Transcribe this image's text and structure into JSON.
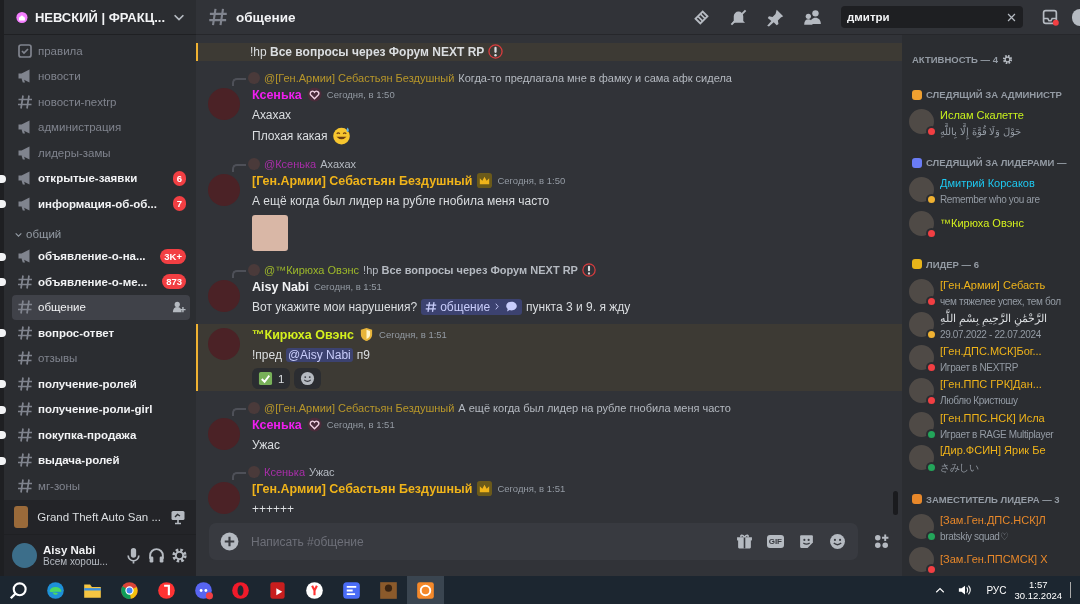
{
  "server": {
    "name": "НЕВСКИЙ | ФРАКЦ..."
  },
  "sidebar": {
    "channels": [
      {
        "name": "правила",
        "kind": "rules",
        "unread": false,
        "selected": false
      },
      {
        "name": "новости",
        "kind": "announce",
        "unread": false,
        "selected": false
      },
      {
        "name": "новости-nextrp",
        "kind": "text",
        "unread": false,
        "selected": false
      },
      {
        "name": "администрация",
        "kind": "announce",
        "unread": false,
        "selected": false
      },
      {
        "name": "лидеры-замы",
        "kind": "announce",
        "unread": false,
        "selected": false
      },
      {
        "name": "открытые-заявки",
        "kind": "announce",
        "unread": true,
        "selected": false,
        "badge": "6"
      },
      {
        "name": "информация-об-об...",
        "kind": "announce",
        "unread": true,
        "selected": false,
        "badge": "7"
      }
    ],
    "categories": [
      {
        "name": "общий",
        "expanded": true,
        "channels": [
          {
            "name": "объявление-о-на...",
            "kind": "announce",
            "unread": true,
            "selected": false,
            "badge": "3K+"
          },
          {
            "name": "объявление-о-ме...",
            "kind": "text",
            "unread": true,
            "selected": false,
            "badge": "873"
          },
          {
            "name": "общение",
            "kind": "text",
            "unread": false,
            "selected": true
          },
          {
            "name": "вопрос-ответ",
            "kind": "text",
            "unread": true,
            "selected": false
          },
          {
            "name": "отзывы",
            "kind": "text",
            "unread": false,
            "selected": false
          },
          {
            "name": "получение-ролей",
            "kind": "text",
            "unread": true,
            "selected": false
          },
          {
            "name": "получение-роли-girl",
            "kind": "text",
            "unread": true,
            "selected": false
          },
          {
            "name": "покупка-продажа",
            "kind": "text",
            "unread": true,
            "selected": false
          },
          {
            "name": "выдача-ролей",
            "kind": "text",
            "unread": true,
            "selected": false
          },
          {
            "name": "мг-зоны",
            "kind": "text",
            "unread": false,
            "selected": false
          }
        ]
      }
    ]
  },
  "activity": {
    "title": "Grand Theft Auto San ..."
  },
  "user": {
    "name": "Aisy Nabi",
    "status_text": "Всем хорош..."
  },
  "header": {
    "channel": "общение",
    "search": {
      "value": "дмитри"
    }
  },
  "messages": [
    {
      "kind": "partial",
      "mentioned": true,
      "lines": [
        [
          {
            "kind": "text",
            "text": "!hp **Все вопросы через Форум NEXT RP**"
          },
          {
            "kind": "alert"
          }
        ]
      ]
    },
    {
      "kind": "message",
      "mentioned": false,
      "reply": {
        "author": "@[Ген.Армии] Себастьян Бездушный",
        "color": "#b8972a",
        "text": "Когда-то предлагала мне в фамку и сама афк сидела"
      },
      "author": "Ксенька",
      "color": "#f01ef0",
      "badge": {
        "kind": "heart"
      },
      "time": "Сегодня, в 1:50",
      "lines": [
        [
          {
            "kind": "text",
            "text": "Ахахах"
          }
        ],
        [
          {
            "kind": "text",
            "text": "Плохая какая"
          },
          {
            "kind": "emoji"
          }
        ]
      ]
    },
    {
      "kind": "message",
      "mentioned": false,
      "reply": {
        "author": "@Ксенька",
        "color": "#a82ea8",
        "text": "Ахахах"
      },
      "author": "[Ген.Армии] Себастьян Бездушный",
      "color": "#f0b41a",
      "badge": {
        "kind": "crown"
      },
      "time": "Сегодня, в 1:50",
      "lines": [
        [
          {
            "kind": "text",
            "text": "А ещё когда был лидер на рубле гнобила меня часто"
          }
        ]
      ],
      "attachment": {
        "kind": "image"
      }
    },
    {
      "kind": "message",
      "mentioned": false,
      "reply": {
        "author": "@™Кирюха Овэнс",
        "color": "#9db82a",
        "text": "!hp **Все вопросы через Форум NEXT RP**",
        "alert": true
      },
      "author": "Aisy Nabi",
      "color": "#f2f3f5",
      "time": "Сегодня, в 1:51",
      "lines": [
        [
          {
            "kind": "text",
            "text": "Вот укажите мои нарушения?"
          },
          {
            "kind": "channel",
            "text": "общение"
          },
          {
            "kind": "text",
            "text": "пункта 3 и 9. я  жду"
          }
        ]
      ]
    },
    {
      "kind": "message",
      "mentioned": true,
      "author": "™Кирюха Овэнс",
      "color": "#d4f01e",
      "badge": {
        "kind": "shield"
      },
      "time": "Сегодня, в 1:51",
      "lines": [
        [
          {
            "kind": "text",
            "text": "!пред"
          },
          {
            "kind": "mention",
            "text": "@Aisy Nabi"
          },
          {
            "kind": "text",
            "text": "п9"
          }
        ]
      ],
      "reactions": [
        {
          "kind": "check",
          "count": "1"
        }
      ]
    },
    {
      "kind": "message",
      "mentioned": false,
      "reply": {
        "author": "@[Ген.Армии] Себастьян Бездушный",
        "color": "#b8972a",
        "text": "А ещё когда был лидер на рубле гнобила меня часто"
      },
      "author": "Ксенька",
      "color": "#f01ef0",
      "badge": {
        "kind": "heart"
      },
      "time": "Сегодня, в 1:51",
      "lines": [
        [
          {
            "kind": "text",
            "text": "Ужас"
          }
        ]
      ]
    },
    {
      "kind": "message",
      "mentioned": false,
      "reply": {
        "author": "Ксенька",
        "color": "#a82ea8",
        "text": "Ужас"
      },
      "author": "[Ген.Армии] Себастьян Бездушный",
      "color": "#f0b41a",
      "badge": {
        "kind": "crown"
      },
      "time": "Сегодня, в 1:51",
      "lines": [
        [
          {
            "kind": "text",
            "text": "++++++"
          }
        ]
      ]
    }
  ],
  "composer": {
    "placeholder": "Написать #общение",
    "gif": "GIF"
  },
  "members": {
    "groups": [
      {
        "kind": "activity",
        "title": "АКТИВНОСТЬ — 4"
      },
      {
        "kind": "role",
        "title": "СЛЕДЯЩИЙ ЗА АДМИНИСТР",
        "color": "#f0a030",
        "members": [
          {
            "name": "Ислам Скалетте",
            "color": "#c8f01e",
            "status": {
              "kind": "dnd"
            },
            "activity": "حَوْلَ وَلَا قُوَّةَ إِلَّا بِاللَّهِ"
          }
        ]
      },
      {
        "kind": "role",
        "title": "СЛЕДЯЩИЙ ЗА ЛИДЕРАМИ —",
        "color": "#6a7cf5",
        "members": [
          {
            "name": "Дмитрий Корсаков",
            "color": "#1ec8f0",
            "status": {
              "kind": "idle"
            },
            "activity": "Remember who you are"
          },
          {
            "name": "™Кирюха Овэнс",
            "color": "#d4f01e",
            "status": {
              "kind": "dnd"
            }
          }
        ]
      },
      {
        "kind": "role",
        "title": "ЛИДЕР — 6",
        "color": "#e8b41a",
        "members": [
          {
            "name": "[Ген.Армии] Себасть",
            "color": "#f0b41a",
            "status": {
              "kind": "dnd"
            },
            "activity": "чем тяжелее успех, тем бол"
          },
          {
            "name": "الرَّحْمَٰنِ الرَّحِيمِ بِسْمِ اللَّهِ",
            "color": "#dbdee1",
            "status": {
              "kind": "idle"
            },
            "activity": "29.07.2022 - 22.07.2024"
          },
          {
            "name": "[Ген.ДПС.МСК]Бог...",
            "color": "#f0b41a",
            "status": {
              "kind": "dnd"
            },
            "activity": "Играет в NEXTRP"
          },
          {
            "name": "[Ген.ППС ГРК]Дан...",
            "color": "#f0b41a",
            "status": {
              "kind": "dnd"
            },
            "activity": "Люблю Кристюшу"
          },
          {
            "name": "[Ген.ППС.НСК] Исла",
            "color": "#f0b41a",
            "status": {
              "kind": "online"
            },
            "activity": "Играет в RAGE Multiplayer"
          },
          {
            "name": "[Дир.ФСИН] Ярик Бе",
            "color": "#f0b41a",
            "status": {
              "kind": "online"
            },
            "activity": "さみしい"
          }
        ]
      },
      {
        "kind": "role",
        "title": "ЗАМЕСТИТЕЛЬ ЛИДЕРА — 3",
        "color": "#e8882a",
        "members": [
          {
            "name": "[Зам.Ген.ДПС.НСК]Л",
            "color": "#e8882a",
            "status": {
              "kind": "online"
            },
            "activity": "bratskiy squad♡"
          },
          {
            "name": "[Зам.Ген.ППСМСК] Х",
            "color": "#e8882a",
            "status": {
              "kind": "dnd"
            }
          }
        ]
      }
    ]
  },
  "taskbar": {
    "language": "РУС",
    "time": "1:57",
    "date": "30.12.2024"
  }
}
